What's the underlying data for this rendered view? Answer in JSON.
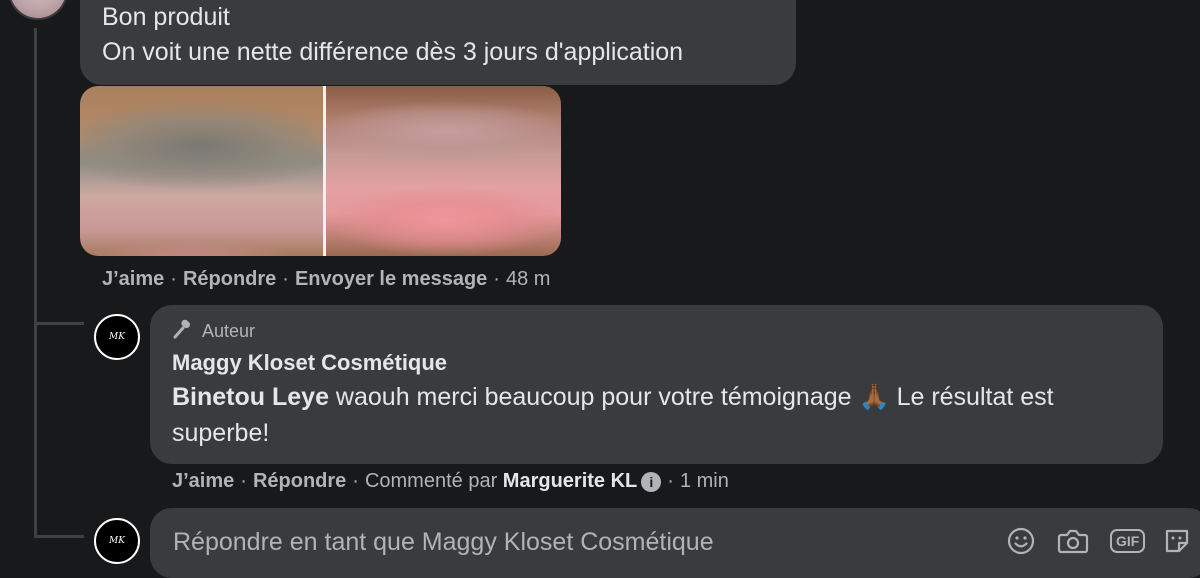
{
  "comment": {
    "lines": [
      "Bon produit",
      "On voit une nette différence dès 3 jours d'application"
    ],
    "actions": {
      "like": "J’aime",
      "reply": "Répondre",
      "send_message": "Envoyer le message",
      "time": "48 m"
    }
  },
  "reply": {
    "badge": "Auteur",
    "author": "Maggy Kloset Cosmétique",
    "mention": "Binetou Leye",
    "text_before_emoji": " waouh merci beaucoup pour votre témoignage ",
    "emoji": "🙏🏾",
    "text_after_emoji": " Le résultat est superbe!",
    "actions": {
      "like": "J’aime",
      "reply": "Répondre",
      "commented_by_label": "Commenté par",
      "commented_by_name": "Marguerite KL",
      "time": "1 min"
    }
  },
  "composer": {
    "placeholder": "Répondre en tant que Maggy Kloset Cosmétique",
    "gif_label": "GIF"
  },
  "icons": {
    "author_badge": "microphone-icon",
    "info": "info-icon",
    "emoji": "smiley-icon",
    "camera": "camera-icon",
    "gif": "gif-icon",
    "sticker": "sticker-icon"
  }
}
